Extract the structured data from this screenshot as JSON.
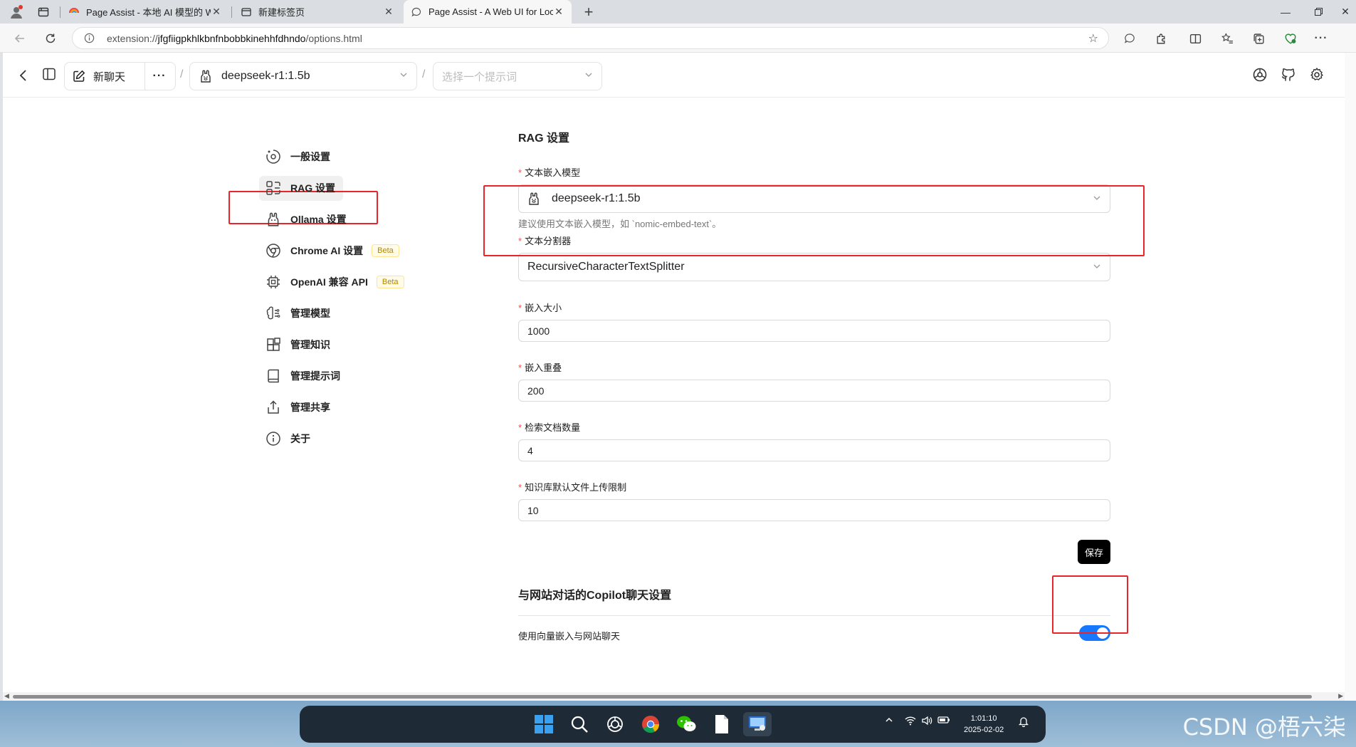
{
  "browser": {
    "tabs": [
      {
        "title": "Page Assist - 本地 AI 模型的 Web",
        "active": false
      },
      {
        "title": "新建标签页",
        "active": false
      },
      {
        "title": "Page Assist - A Web UI for Local A",
        "active": true
      }
    ],
    "url_prefix": "extension://",
    "url_host": "jfgfiigpkhlkbnfnbobbkinehhfdhndo",
    "url_path": "/options.html"
  },
  "app_header": {
    "new_chat_label": "新聊天",
    "more_label": "···",
    "model_name": "deepseek-r1:1.5b",
    "prompt_placeholder": "选择一个提示词",
    "separator": "/"
  },
  "sidebar": {
    "items": [
      {
        "label": "一般设置",
        "icon": "general-settings-icon"
      },
      {
        "label": "RAG 设置",
        "icon": "rag-icon",
        "active": true
      },
      {
        "label": "Ollama 设置",
        "icon": "ollama-icon"
      },
      {
        "label": "Chrome AI 设置",
        "icon": "chrome-icon",
        "badge": "Beta"
      },
      {
        "label": "OpenAI 兼容 API",
        "icon": "cpu-icon",
        "badge": "Beta"
      },
      {
        "label": "管理模型",
        "icon": "brain-icon"
      },
      {
        "label": "管理知识",
        "icon": "blocks-icon"
      },
      {
        "label": "管理提示词",
        "icon": "book-icon"
      },
      {
        "label": "管理共享",
        "icon": "share-icon"
      },
      {
        "label": "关于",
        "icon": "info-icon"
      }
    ]
  },
  "rag_form": {
    "title": "RAG 设置",
    "required_mark": "*",
    "embedding_model": {
      "label": "文本嵌入模型",
      "value": "deepseek-r1:1.5b",
      "help": "建议使用文本嵌入模型，如 `nomic-embed-text`。"
    },
    "splitter": {
      "label": "文本分割器",
      "value": "RecursiveCharacterTextSplitter"
    },
    "chunk_size": {
      "label": "嵌入大小",
      "value": "1000"
    },
    "chunk_overlap": {
      "label": "嵌入重叠",
      "value": "200"
    },
    "retrieval_count": {
      "label": "检索文档数量",
      "value": "4"
    },
    "upload_limit": {
      "label": "知识库默认文件上传限制",
      "value": "10"
    },
    "save_label": "保存"
  },
  "copilot": {
    "title": "与网站对话的Copilot聊天设置",
    "vector_embed_label": "使用向量嵌入与网站聊天",
    "vector_embed_enabled": true
  },
  "taskbar": {
    "time": "1:01:10",
    "date": "2025-02-02",
    "watermark": "CSDN @梧六柒"
  },
  "colors": {
    "accent_toggle": "#1677ff",
    "annotation_red": "#e8262a",
    "save_button": "#000000"
  }
}
